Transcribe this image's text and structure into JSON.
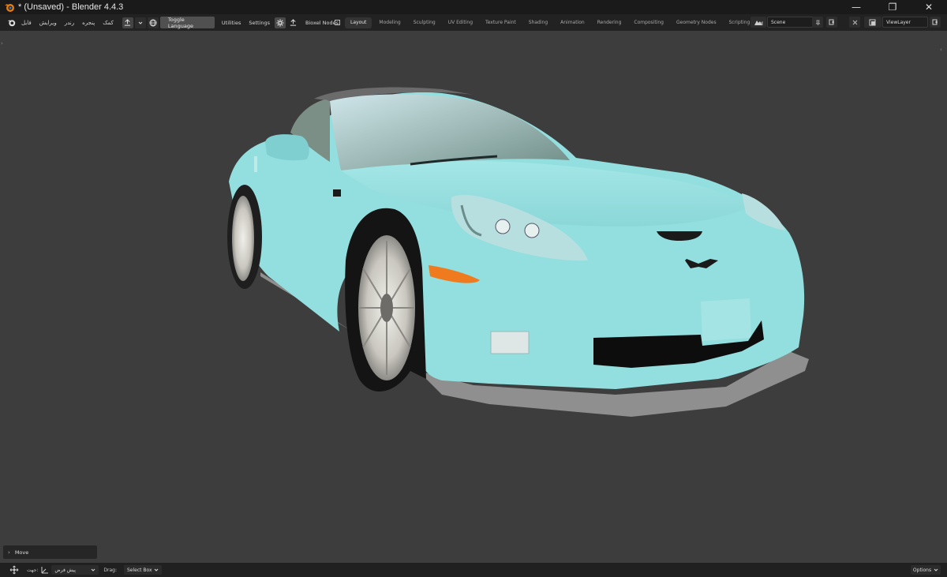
{
  "window": {
    "title": "* (Unsaved) - Blender 4.4.3",
    "min_glyph": "—",
    "max_glyph": "❐",
    "close_glyph": "✕"
  },
  "menu": {
    "items": [
      "فایل",
      "ویرایش",
      "رندر",
      "پنجره",
      "کمک"
    ],
    "toggle_language": "Toggle Language",
    "utilities": "Utilities",
    "settings": "Settings",
    "bioxel_nodes": "Bioxel Nodes"
  },
  "workspaces": {
    "tabs": [
      "Layout",
      "Modeling",
      "Sculpting",
      "UV Editing",
      "Texture Paint",
      "Shading",
      "Animation",
      "Rendering",
      "Compositing",
      "Geometry Nodes",
      "Scripting"
    ],
    "active": "Layout",
    "add_glyph": "+"
  },
  "scene": {
    "name": "Scene",
    "view_layer": "ViewLayer"
  },
  "operator_panel": {
    "title": "Move"
  },
  "statusbar": {
    "direction_label": "جهت:",
    "direction_value": "پیش فرض",
    "drag_label": "Drag:",
    "drag_value": "Select Box",
    "options_label": "Options"
  },
  "colors": {
    "car_body": "#93dede",
    "viewport_bg": "#3d3d3d",
    "header_bg": "#222222"
  }
}
